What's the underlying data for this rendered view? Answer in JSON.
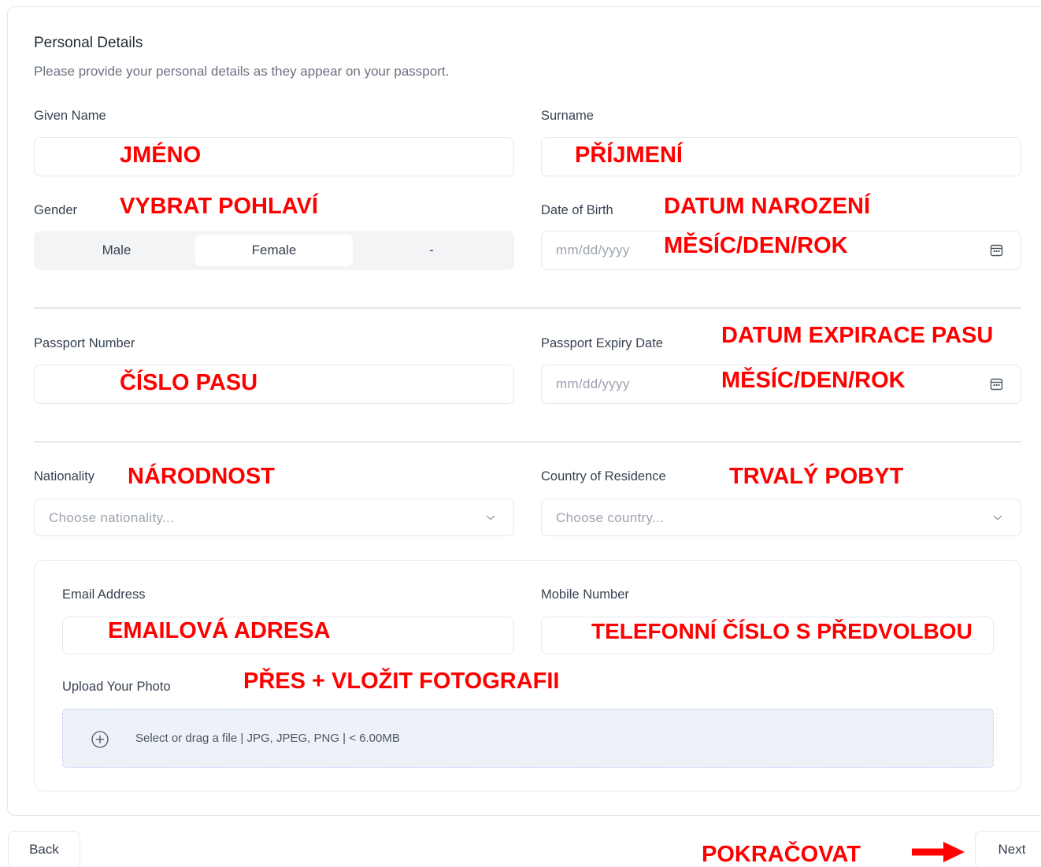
{
  "header": {
    "title": "Personal Details",
    "subtitle": "Please provide your personal details as they appear on your passport."
  },
  "fields": {
    "given_name": {
      "label": "Given Name",
      "value": ""
    },
    "surname": {
      "label": "Surname",
      "value": ""
    },
    "gender": {
      "label": "Gender",
      "options": [
        "Male",
        "Female",
        "-"
      ],
      "selected": "Female"
    },
    "dob": {
      "label": "Date of Birth",
      "placeholder": "mm/dd/yyyy"
    },
    "passport_number": {
      "label": "Passport Number",
      "value": ""
    },
    "passport_expiry": {
      "label": "Passport Expiry Date",
      "placeholder": "mm/dd/yyyy"
    },
    "nationality": {
      "label": "Nationality",
      "placeholder": "Choose nationality..."
    },
    "residence": {
      "label": "Country of Residence",
      "placeholder": "Choose country..."
    },
    "email": {
      "label": "Email Address",
      "value": ""
    },
    "mobile": {
      "label": "Mobile Number",
      "value": ""
    },
    "photo": {
      "label": "Upload Your Photo",
      "hint": "Select or drag a file | JPG, JPEG, PNG | < 6.00MB"
    }
  },
  "annotations": {
    "given_name": "JMÉNO",
    "surname": "PŘÍJMENÍ",
    "gender": "VYBRAT POHLAVÍ",
    "dob": "DATUM NAROZENÍ",
    "dob_format": "MĚSÍC/DEN/ROK",
    "passport_expiry": "DATUM EXPIRACE PASU",
    "passport_expiry_format": "MĚSÍC/DEN/ROK",
    "passport_number": "ČÍSLO PASU",
    "nationality": "NÁRODNOST",
    "residence": "TRVALÝ POBYT",
    "email": "EMAILOVÁ ADRESA",
    "mobile": "TELEFONNÍ ČÍSLO S PŘEDVOLBOU",
    "photo": "PŘES + VLOŽIT FOTOGRAFII",
    "next": "POKRAČOVAT"
  },
  "nav": {
    "back_label": "Back",
    "next_label": "Next"
  },
  "colors": {
    "annotation": "#ff0000",
    "border": "#e5e7eb",
    "dropzone_bg": "#eef2f8"
  }
}
